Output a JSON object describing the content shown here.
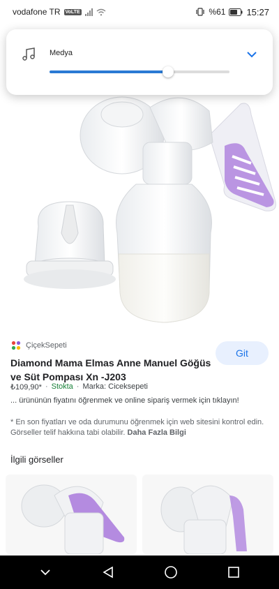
{
  "status_bar": {
    "carrier": "vodafone TR",
    "volte_badge": "VoLTE",
    "battery": "%61",
    "time": "15:27"
  },
  "volume_panel": {
    "label": "Medya",
    "level_fraction": 0.66,
    "accent_color": "#2a7ad4"
  },
  "result": {
    "source": "ÇiçekSepeti",
    "go_label": "Git",
    "title": "Diamond Mama Elmas Anne Manuel Göğüs ve Süt Pompası Xn -J203",
    "price": "₺109,90*",
    "stock": "Stokta",
    "brand": "Marka: Ciceksepeti",
    "description": "... ürününün fiyatını öğrenmek ve online sipariş vermek için tıklayın!",
    "note": "* En son fiyatları ve oda durumunu öğrenmek için web sitesini kontrol edin. Görseller telif hakkına tabi olabilir.",
    "note_link": "Daha Fazla Bilgi"
  },
  "related": {
    "title": "İlgili görseller"
  },
  "colors": {
    "stock_green": "#188038",
    "link_blue": "#1a73e8",
    "pump_purple": "#b48be0"
  }
}
